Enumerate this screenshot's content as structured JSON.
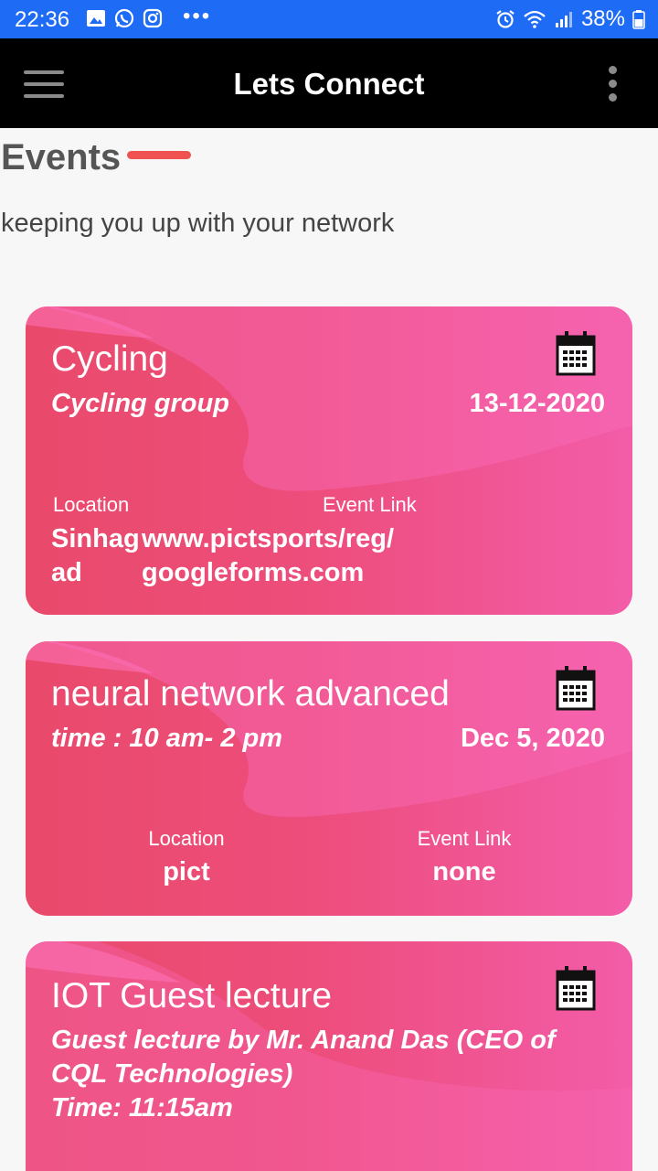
{
  "status_bar": {
    "time": "22:36",
    "more": "•••",
    "battery": "38%",
    "icons": [
      "gallery-icon",
      "whatsapp-icon",
      "instagram-icon",
      "alarm-icon",
      "wifi-icon",
      "signal-icon",
      "battery-icon"
    ]
  },
  "app_bar": {
    "title": "Lets Connect",
    "menu_icon": "hamburger-menu-icon",
    "overflow_icon": "more-vert-icon"
  },
  "header": {
    "title": "Events",
    "subtitle": "keeping you up with your network",
    "accent": "#f05252"
  },
  "events": [
    {
      "title": "Cycling",
      "subtitle": "Cycling group",
      "date": "13-12-2020",
      "location_label": "Location",
      "location_lines": [
        "Sinhag",
        "ad"
      ],
      "link_label": "Event Link",
      "link_lines": [
        "www.pictsports/reg/",
        "googleforms.com"
      ]
    },
    {
      "title": "neural network advanced",
      "subtitle": "time : 10 am- 2 pm",
      "date": "Dec 5, 2020",
      "location_label": "Location",
      "location_lines": [
        "pict"
      ],
      "link_label": "Event Link",
      "link_lines": [
        "none"
      ]
    },
    {
      "title": "IOT Guest lecture",
      "subtitle_lines": [
        "Guest lecture by Mr. Anand Das (CEO of",
        "CQL Technologies)",
        "Time: 11:15am"
      ]
    }
  ],
  "colors": {
    "status_bar": "#1e6cf5",
    "app_bar": "#000000",
    "card_start": "#e94a6b",
    "card_end": "#f35ca8"
  }
}
